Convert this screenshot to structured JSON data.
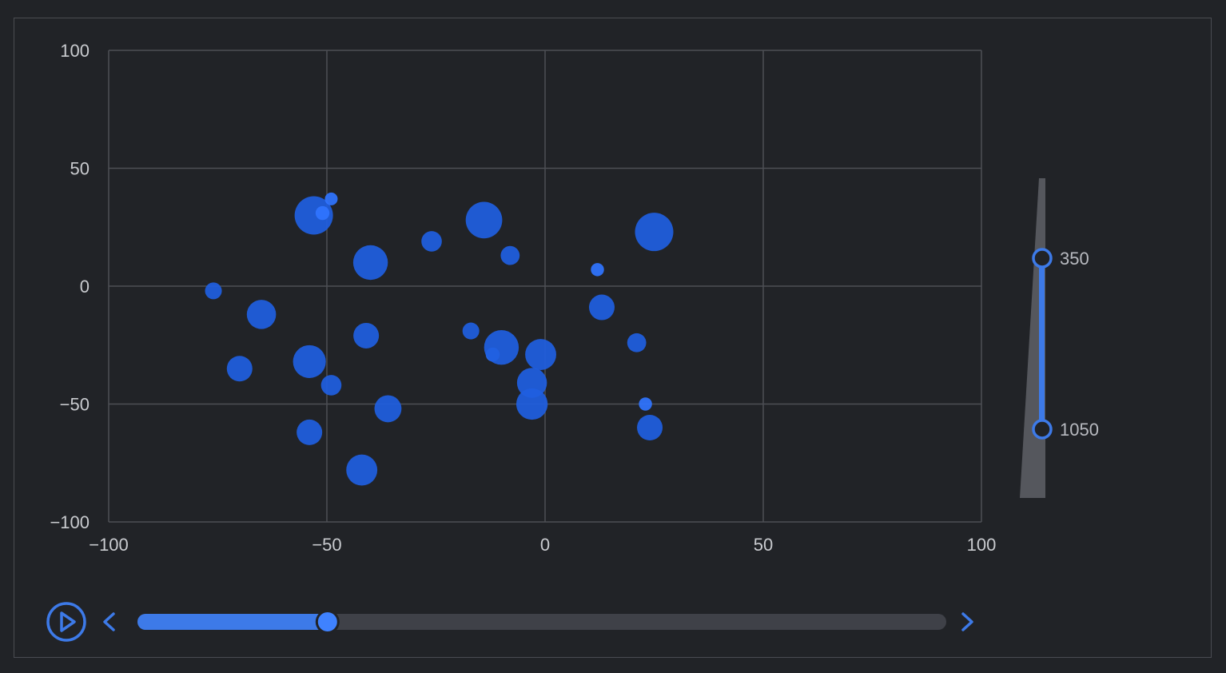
{
  "colors": {
    "background": "#212327",
    "panel_border": "#4a4c52",
    "grid": "#4d4f55",
    "point": "#1f5fe0",
    "point_highlight": "#2f74ff",
    "accent": "#3d7ae8",
    "track": "#3f4148",
    "text": "#c9cbcf"
  },
  "chart_data": {
    "type": "scatter",
    "xlim": [
      -100,
      100
    ],
    "ylim": [
      -100,
      100
    ],
    "x_ticks": [
      -100,
      -50,
      0,
      50,
      100
    ],
    "y_ticks": [
      -100,
      -50,
      0,
      50,
      100
    ],
    "x_tick_labels": [
      "−100",
      "−50",
      "0",
      "50",
      "100"
    ],
    "y_tick_labels": [
      "−100",
      "−50",
      "0",
      "50",
      "100"
    ],
    "grid": true,
    "points": [
      {
        "x": -76,
        "y": -2,
        "size": 460
      },
      {
        "x": -65,
        "y": -12,
        "size": 800
      },
      {
        "x": -70,
        "y": -35,
        "size": 700
      },
      {
        "x": -54,
        "y": -32,
        "size": 900
      },
      {
        "x": -53,
        "y": 30,
        "size": 1050
      },
      {
        "x": -51,
        "y": 31,
        "size": 380
      },
      {
        "x": -49,
        "y": 37,
        "size": 350
      },
      {
        "x": -49,
        "y": -42,
        "size": 560
      },
      {
        "x": -54,
        "y": -62,
        "size": 700
      },
      {
        "x": -41,
        "y": -21,
        "size": 700
      },
      {
        "x": -40,
        "y": 10,
        "size": 950
      },
      {
        "x": -42,
        "y": -78,
        "size": 850
      },
      {
        "x": -36,
        "y": -52,
        "size": 740
      },
      {
        "x": -26,
        "y": 19,
        "size": 560
      },
      {
        "x": -17,
        "y": -19,
        "size": 460
      },
      {
        "x": -14,
        "y": 28,
        "size": 1000
      },
      {
        "x": -12,
        "y": -29,
        "size": 380
      },
      {
        "x": -10,
        "y": -26,
        "size": 950
      },
      {
        "x": -8,
        "y": 13,
        "size": 520
      },
      {
        "x": -3,
        "y": -41,
        "size": 820
      },
      {
        "x": -3,
        "y": -50,
        "size": 860
      },
      {
        "x": -1,
        "y": -29,
        "size": 850
      },
      {
        "x": 12,
        "y": 7,
        "size": 360
      },
      {
        "x": 13,
        "y": -9,
        "size": 700
      },
      {
        "x": 21,
        "y": -24,
        "size": 520
      },
      {
        "x": 23,
        "y": -50,
        "size": 360
      },
      {
        "x": 24,
        "y": -60,
        "size": 700
      },
      {
        "x": 25,
        "y": 23,
        "size": 1050
      }
    ]
  },
  "visual_map": {
    "min": 350,
    "max": 1050,
    "range_low": 350,
    "range_high": 1050,
    "label_low": "350",
    "label_high": "1050"
  },
  "timeline": {
    "progress": 0.235,
    "play_icon": "play-icon",
    "prev_icon": "chevron-left-icon",
    "next_icon": "chevron-right-icon"
  }
}
